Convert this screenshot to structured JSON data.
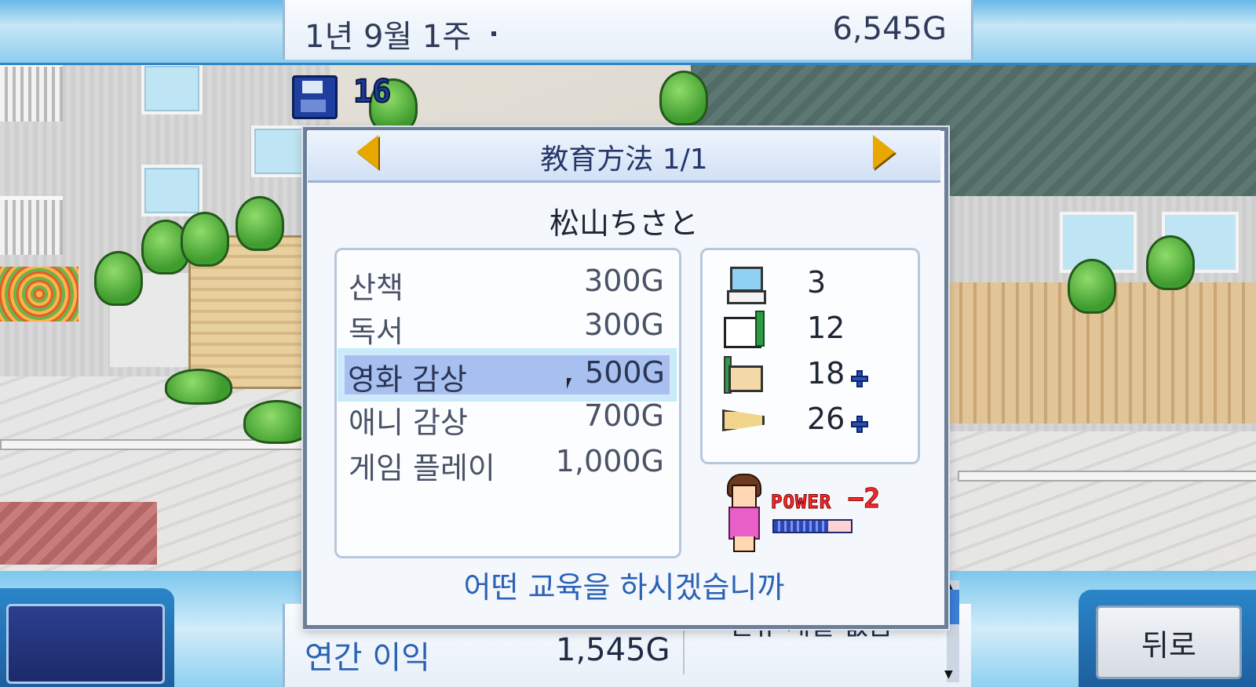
{
  "top_bar": {
    "date": "1년 9월 1주",
    "money": "6,545G"
  },
  "save": {
    "icon": "floppy-disk-icon",
    "count": "16"
  },
  "dialog": {
    "title": "教育方法 1/1",
    "character_name": "松山ちさと",
    "items": [
      {
        "name": "산책",
        "price": "300G"
      },
      {
        "name": "독서",
        "price": "300G"
      },
      {
        "name": "영화 감상",
        "price": "500G"
      },
      {
        "name": "애니 감상",
        "price": "700G"
      },
      {
        "name": "게임 플레이",
        "price": "1,000G"
      }
    ],
    "selected_index": 2,
    "stats": [
      {
        "icon": "computer-icon",
        "value": "3",
        "boosted": false
      },
      {
        "icon": "book-icon",
        "value": "12",
        "boosted": false
      },
      {
        "icon": "graphics-icon",
        "value": "18",
        "boosted": true
      },
      {
        "icon": "sound-icon",
        "value": "26",
        "boosted": true
      }
    ],
    "power": {
      "label": "POWER",
      "value": "−2",
      "level": 0.7
    },
    "prompt": "어떤 교육을 하시겠습니까"
  },
  "bottom_bar": {
    "profit_label": "연간 이익",
    "profit_value": "1,545G",
    "news_text": "신규 개발 없음",
    "back_label": "뒤로"
  },
  "colors": {
    "accent_blue": "#2b62b5",
    "selection": "#a8c0ef",
    "power_red": "#ff2a2a",
    "arrow_gold": "#e8a800"
  }
}
